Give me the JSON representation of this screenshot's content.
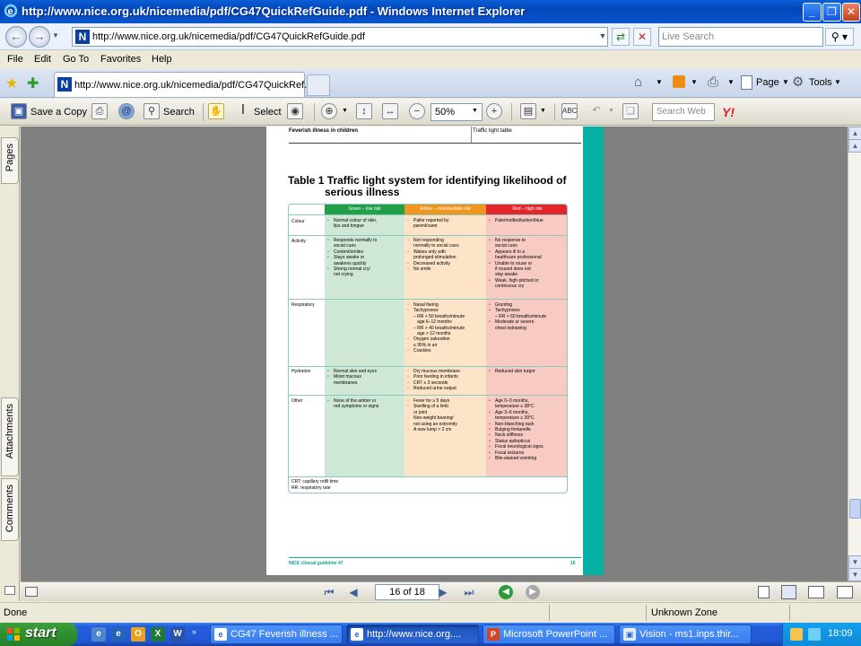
{
  "window": {
    "title": "http://www.nice.org.uk/nicemedia/pdf/CG47QuickRefGuide.pdf - Windows Internet Explorer"
  },
  "addressbar": {
    "url": "http://www.nice.org.uk/nicemedia/pdf/CG47QuickRefGuide.pdf",
    "search_placeholder": "Live Search"
  },
  "menu": {
    "items": [
      "File",
      "Edit",
      "Go To",
      "Favorites",
      "Help"
    ]
  },
  "tabs": {
    "active_title": "http://www.nice.org.uk/nicemedia/pdf/CG47QuickRef...",
    "page_label": "Page",
    "tools_label": "Tools"
  },
  "pdf_toolbar": {
    "save_copy": "Save a Copy",
    "search": "Search",
    "select": "Select",
    "zoom": "50%",
    "web_search_placeholder": "Search Web"
  },
  "side_tabs": {
    "pages": "Pages",
    "attachments": "Attachments",
    "comments": "Comments"
  },
  "document": {
    "header_left": "Feverish illness in children",
    "header_right": "Traffic light table",
    "table_title_1": "Table 1  Traffic light system for identifying likelihood of",
    "table_title_2": "serious illness",
    "columns": {
      "green": "Green – low risk",
      "amber": "Amber – intermediate risk",
      "red": "Red – high risk"
    },
    "rows": {
      "colour": {
        "label": "Colour",
        "green": [
          "Normal colour of skin,\nlips and tongue"
        ],
        "amber": [
          "Pallor reported by\nparent/carer"
        ],
        "red": [
          "Pale/mottled/ashen/blue"
        ]
      },
      "activity": {
        "label": "Activity",
        "green": [
          "Responds normally to\nsocial cues",
          "Content/smiles",
          "Stays awake or\nawakens quickly",
          "Strong normal cry/\nnot crying"
        ],
        "amber": [
          "Not responding\nnormally to social cues",
          "Wakes only with\nprolonged stimulation",
          "Decreased activity",
          "No smile"
        ],
        "red": [
          "No response to\nsocial cues",
          "Appears ill to a\nhealthcare professional",
          "Unable to rouse or\nif roused does not\nstay awake",
          "Weak, high-pitched or\ncontinuous cry"
        ]
      },
      "respiratory": {
        "label": "Respiratory",
        "amber": [
          "Nasal flaring",
          "Tachypnoea:\n– RR > 50 breaths/minute\n   age 6–12 months\n– RR > 40 breaths/minute\n   age > 12 months",
          "Oxygen saturation\n≤ 95% in air",
          "Crackles"
        ],
        "red": [
          "Grunting",
          "Tachypnoea:\n– RR > 60 breaths/minute",
          "Moderate or severe\nchest indrawing"
        ]
      },
      "hydration": {
        "label": "Hydration",
        "green": [
          "Normal skin and eyes",
          "Moist mucous\nmembranes"
        ],
        "amber": [
          "Dry mucous membrane",
          "Poor feeding in infants",
          "CRT ≥ 3 seconds",
          "Reduced urine output"
        ],
        "red": [
          "Reduced skin turgor"
        ]
      },
      "other": {
        "label": "Other",
        "green": [
          "None of the amber or\nred symptoms or signs"
        ],
        "amber": [
          "Fever for ≥ 5 days",
          "Swelling of a limb\nor joint",
          "Non-weight bearing/\nnot using an extremity",
          "A new lump > 2 cm"
        ],
        "red": [
          "Age 0–3 months,\ntemperature ≥ 38°C",
          "Age 3–6 months,\ntemperature ≥ 39°C",
          "Non-blanching rash",
          "Bulging fontanelle",
          "Neck stiffness",
          "Status epilepticus",
          "Focal neurological signs",
          "Focal seizures",
          "Bile-stained vomiting"
        ]
      }
    },
    "footnote_1": "CRT: capillary refill time",
    "footnote_2": "RR: respiratory rate",
    "page_footer_left": "NICE clinical guideline 47",
    "page_footer_right": "16"
  },
  "navigation": {
    "page_display": "16 of 18"
  },
  "status": {
    "left": "Done",
    "zone": "Unknown Zone"
  },
  "taskbar": {
    "start": "start",
    "tasks": [
      "CG47 Feverish illness ...",
      "http://www.nice.org....",
      "Microsoft PowerPoint ...",
      "Vision - ms1.inps.thir..."
    ],
    "clock": "18:09"
  }
}
